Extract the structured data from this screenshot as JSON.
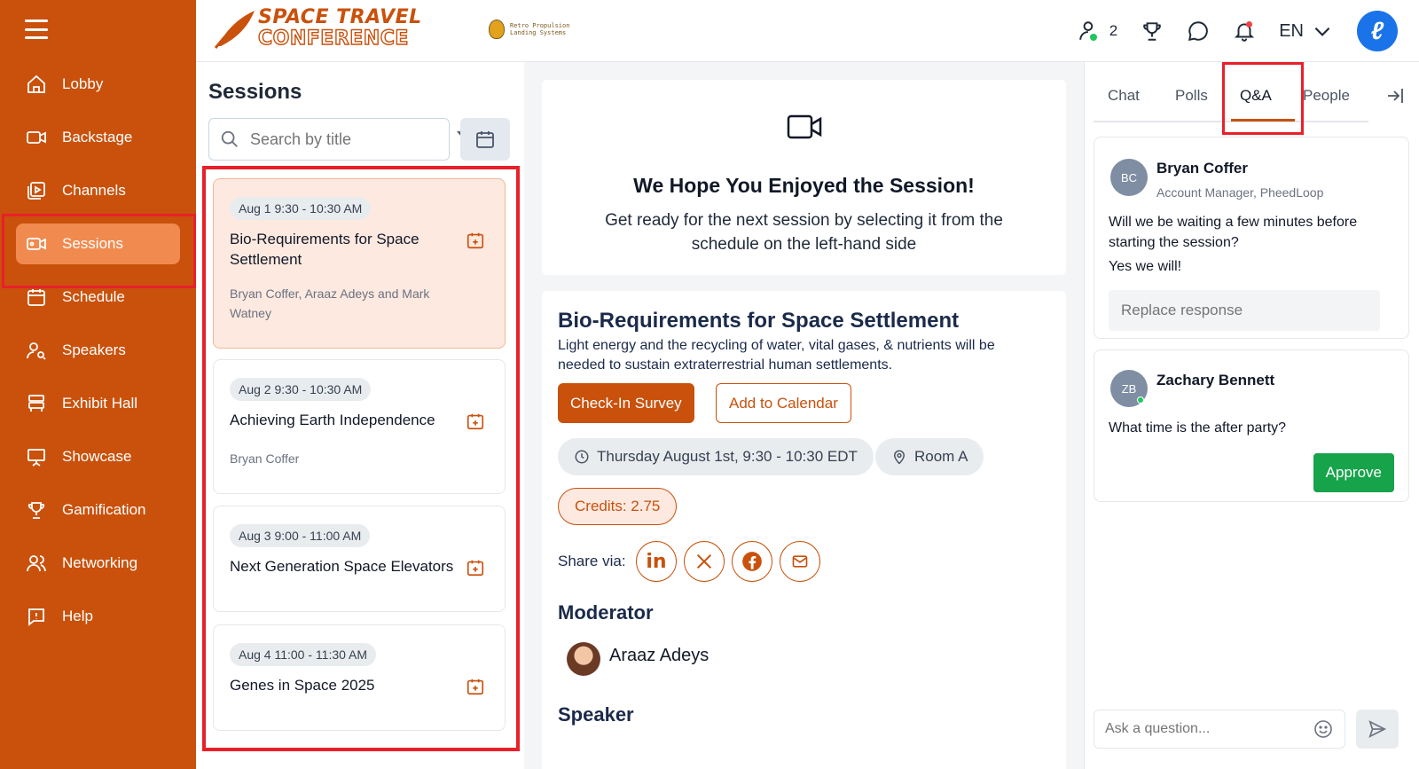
{
  "sidebar": {
    "items": [
      {
        "label": "Lobby",
        "icon": "home-icon"
      },
      {
        "label": "Backstage",
        "icon": "video-camera-icon"
      },
      {
        "label": "Channels",
        "icon": "play-stack-icon"
      },
      {
        "label": "Sessions",
        "icon": "video-camera-icon"
      },
      {
        "label": "Schedule",
        "icon": "calendar-icon"
      },
      {
        "label": "Speakers",
        "icon": "speaker-person-icon"
      },
      {
        "label": "Exhibit Hall",
        "icon": "booth-icon"
      },
      {
        "label": "Showcase",
        "icon": "presentation-icon"
      },
      {
        "label": "Gamification",
        "icon": "trophy-icon"
      },
      {
        "label": "Networking",
        "icon": "people-icon"
      },
      {
        "label": "Help",
        "icon": "help-icon"
      }
    ],
    "active_item": "Sessions"
  },
  "header": {
    "logo_line1": "SPACE TRAVEL",
    "logo_line2": "CONFERENCE",
    "sponsor_line1": "Retro Propulsion",
    "sponsor_line2": "Landing Systems",
    "online_count": "2",
    "language": "EN",
    "colors": {
      "brand": "#c9510c",
      "avatar": "#1a73e8"
    }
  },
  "sessions": {
    "title": "Sessions",
    "search_placeholder": "Search by title",
    "list": [
      {
        "date": "Aug 1 9:30 - 10:30 AM",
        "title": "Bio-Requirements for Space Settlement",
        "speakers": "Bryan Coffer, Araaz Adeys and Mark Watney"
      },
      {
        "date": "Aug 2 9:30 - 10:30 AM",
        "title": "Achieving Earth Independence",
        "speakers": "Bryan Coffer"
      },
      {
        "date": "Aug 3 9:00 - 11:00 AM",
        "title": "Next Generation Space Elevators",
        "speakers": ""
      },
      {
        "date": "Aug 4 11:00 - 11:30 AM",
        "title": "Genes in Space 2025",
        "speakers": ""
      }
    ]
  },
  "main": {
    "enjoy_title": "We Hope You Enjoyed the Session!",
    "enjoy_text": "Get ready for the next session by selecting it from the schedule on the left-hand side",
    "session_title": "Bio-Requirements for Space Settlement",
    "session_desc": "Light energy and the recycling of water, vital gases, & nutrients will be needed to sustain extraterrestrial human settlements.",
    "checkin_label": "Check-In Survey",
    "calendar_label": "Add to Calendar",
    "time_label": "Thursday August 1st, 9:30 - 10:30 EDT",
    "room_label": "Room A",
    "credits_label": "Credits: 2.75",
    "share_label": "Share via:",
    "moderator_heading": "Moderator",
    "moderator_name": "Araaz Adeys",
    "speaker_heading": "Speaker"
  },
  "rpanel": {
    "tabs": [
      "Chat",
      "Polls",
      "Q&A",
      "People"
    ],
    "active_tab": "Q&A",
    "questions": [
      {
        "initials": "BC",
        "name": "Bryan Coffer",
        "role": "Account Manager, PheedLoop",
        "question": "Will we be waiting a few minutes before starting the session?",
        "answer": "Yes we will!",
        "reply_placeholder": "Replace response"
      },
      {
        "initials": "ZB",
        "name": "Zachary Bennett",
        "question": "What time is the after party?",
        "action_label": "Approve"
      }
    ],
    "ask_placeholder": "Ask a question..."
  }
}
